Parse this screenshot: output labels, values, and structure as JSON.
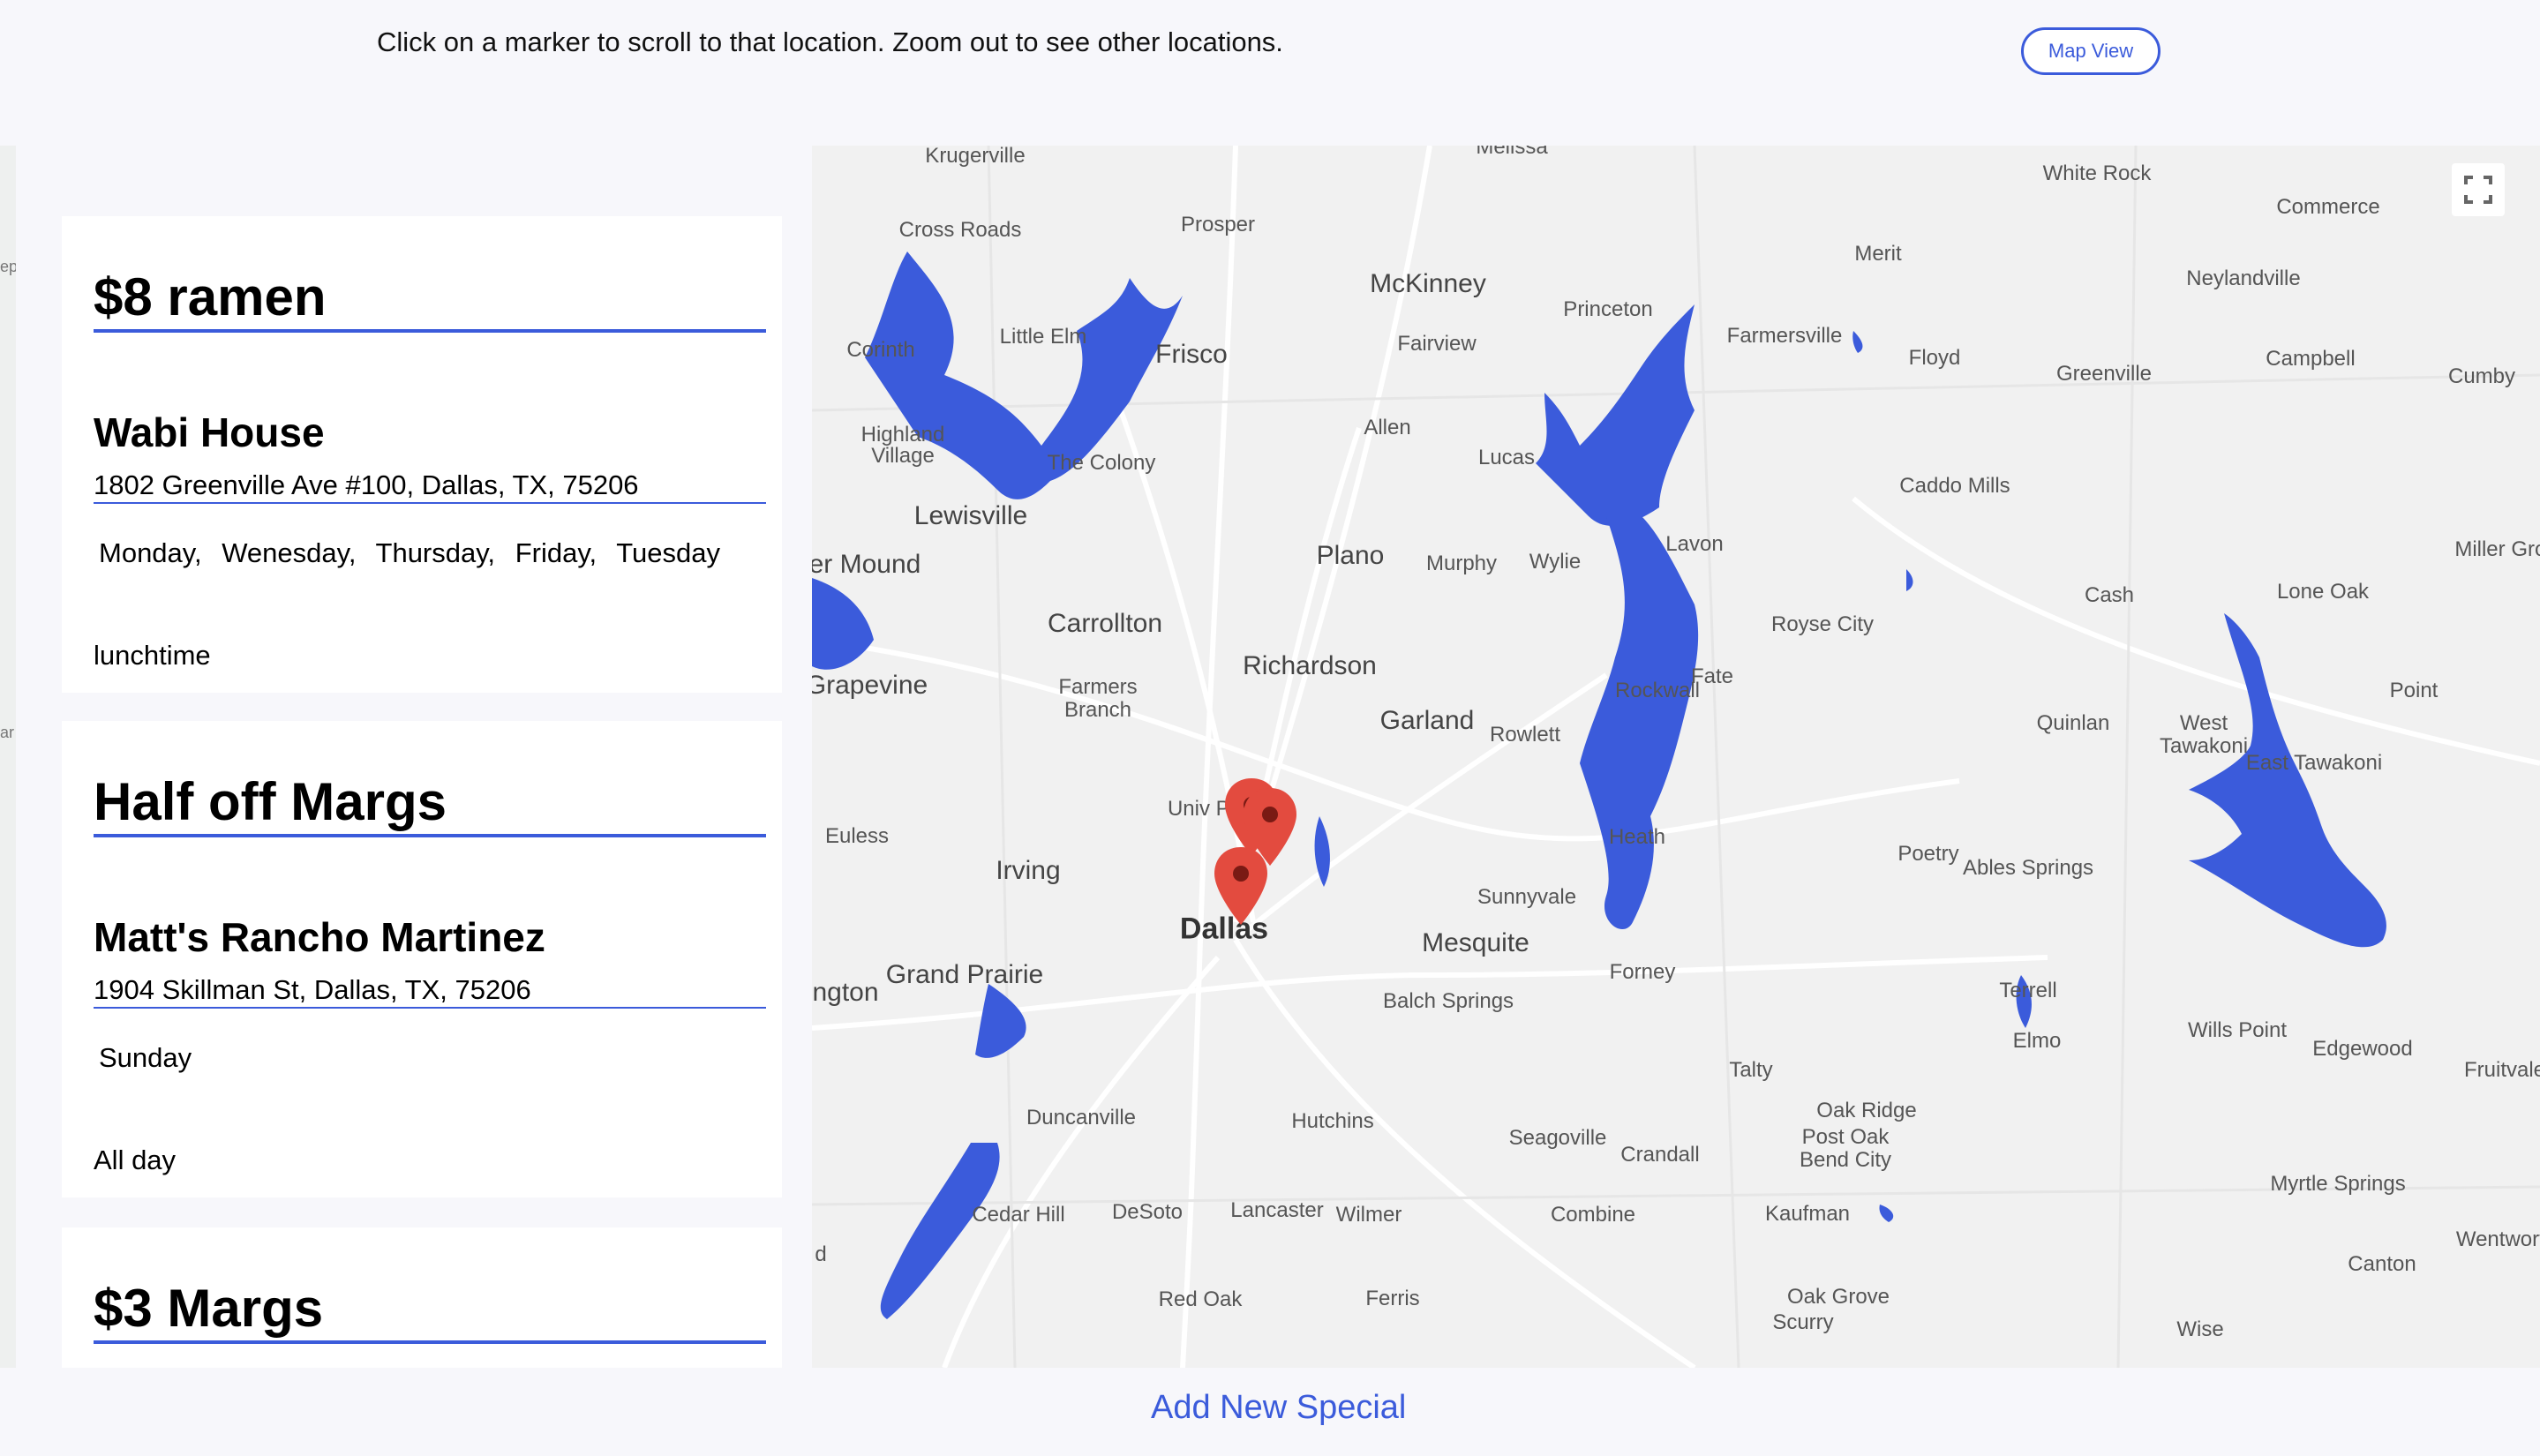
{
  "header": {
    "instructions": "Click on a marker to scroll to that location. Zoom out to see other locations.",
    "map_view_label": "Map View"
  },
  "left_edge": [
    "ep",
    "ar"
  ],
  "specials": [
    {
      "title": "$8 ramen",
      "restaurant": "Wabi House",
      "address": "1802 Greenville Ave #100, Dallas, TX, 75206",
      "days": [
        "Monday,",
        "Wenesday,",
        "Thursday,",
        "Friday,",
        "Tuesday"
      ],
      "time": "lunchtime"
    },
    {
      "title": "Half off Margs",
      "restaurant": "Matt's Rancho Martinez",
      "address": "1904 Skillman St, Dallas, TX, 75206",
      "days": [
        "Sunday"
      ],
      "time": "All day"
    },
    {
      "title": "$3 Margs"
    }
  ],
  "map": {
    "water_color": "#3b5bdb",
    "marker_color": "#e34b3f",
    "labels": [
      "Krugerville",
      "Melissa",
      "White Rock",
      "Commerce",
      "Cross Roads",
      "Prosper",
      "McKinney",
      "Merit",
      "Neylandville",
      "Little Elm",
      "Frisco",
      "Princeton",
      "Farmersville",
      "Corinth",
      "Fairview",
      "Floyd",
      "Greenville",
      "Campbell",
      "Cumby",
      "Highland Village",
      "Allen",
      "Lucas",
      "Caddo Mills",
      "The Colony",
      "Lewisville",
      "Plano",
      "Murphy",
      "Wylie",
      "Lavon",
      "Miller Grove",
      "er Mound",
      "Carrollton",
      "Royse City",
      "Cash",
      "Lone Oak",
      "Richardson",
      "Fate",
      "Grapevine",
      "Farmers Branch",
      "Garland",
      "Rockwall",
      "Quinlan",
      "Point",
      "Rowlett",
      "West Tawakoni",
      "East Tawakoni",
      "Univ Pa",
      "Euless",
      "Heath",
      "Poetry",
      "Ables Springs",
      "Irving",
      "Sunnyvale",
      "Dallas",
      "Mesquite",
      "Grand Prairie",
      "Forney",
      "ngton",
      "Terrell",
      "Balch Springs",
      "Elmo",
      "Wills Point",
      "Edgewood",
      "Fruitvale",
      "Talty",
      "Duncanville",
      "Hutchins",
      "Seagoville",
      "Oak Ridge",
      "Crandall",
      "Post Oak Bend City",
      "Cedar Hill",
      "DeSoto",
      "Lancaster",
      "Wilmer",
      "Combine",
      "Kaufman",
      "Myrtle Springs",
      "Wentworth",
      "Canton",
      "Red Oak",
      "Ferris",
      "Oak Grove",
      "Scurry",
      "Wise",
      "d"
    ]
  },
  "footer": {
    "add_label": "Add New Special"
  }
}
